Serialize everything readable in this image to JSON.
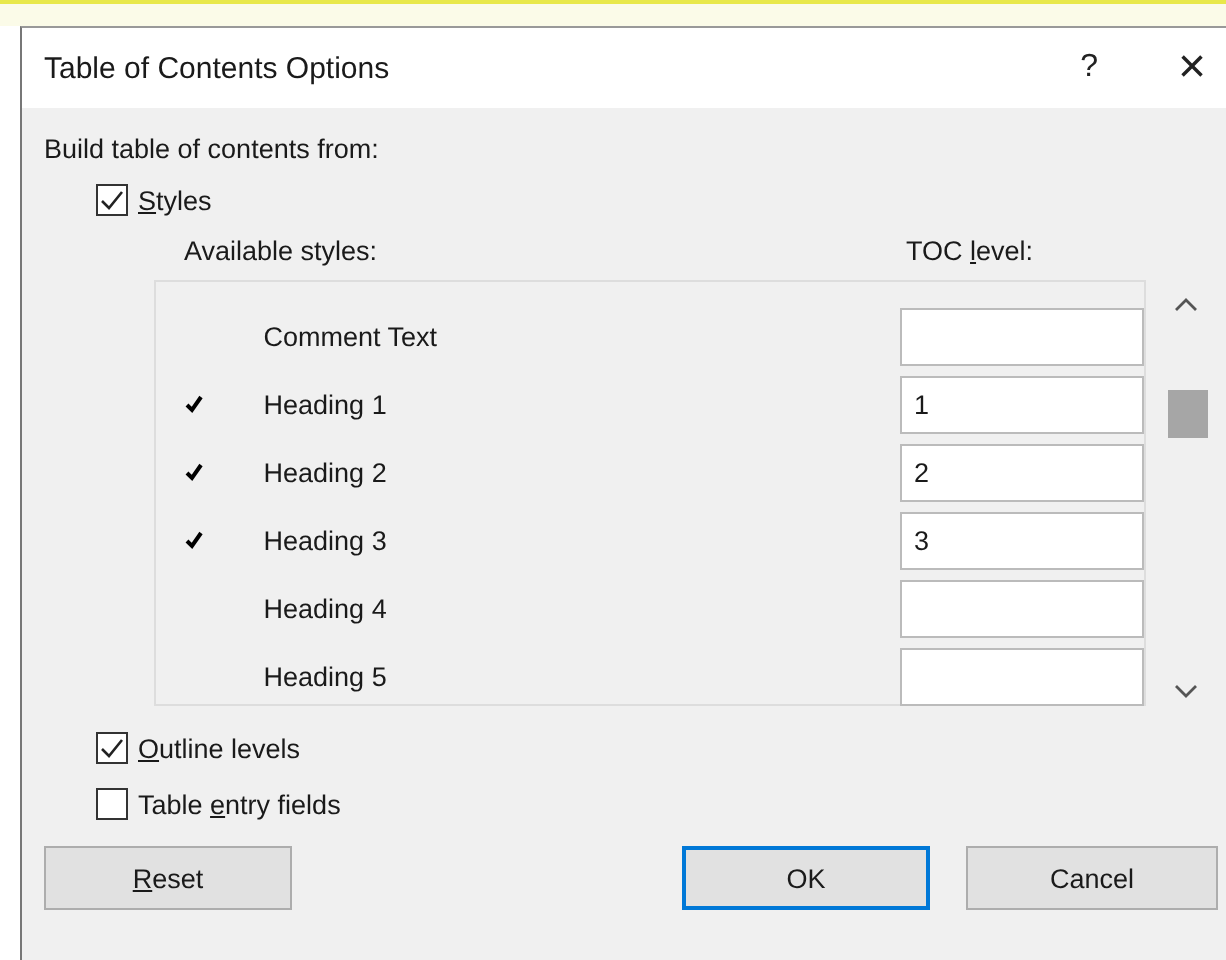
{
  "window": {
    "title": "Table of Contents Options",
    "help": "?",
    "close": "×"
  },
  "build_label": "Build table of contents from:",
  "styles_option": {
    "label": {
      "key": "S",
      "after": "tyles"
    },
    "checked": true
  },
  "columns": {
    "styles": "Available styles:",
    "level_label": {
      "before": "TOC ",
      "key": "l",
      "after": "evel:"
    }
  },
  "styles": [
    {
      "name": "Comment Text",
      "used": false
    },
    {
      "name": "Heading 1",
      "used": true,
      "level": "1"
    },
    {
      "name": "Heading 2",
      "used": true,
      "level": "2"
    },
    {
      "name": "Heading 3",
      "used": true,
      "level": "3"
    },
    {
      "name": "Heading 4",
      "used": false
    },
    {
      "name": "Heading 5",
      "used": false
    }
  ],
  "options": [
    {
      "label": {
        "key": "O",
        "after": "utline levels"
      },
      "checked": true
    },
    {
      "label": {
        "before": "Table ",
        "key": "e",
        "after": "ntry fields"
      },
      "checked": false
    }
  ],
  "buttons": [
    {
      "label": {
        "key": "R",
        "after": "eset"
      },
      "kind": "normal"
    },
    {
      "label": {
        "after": "OK"
      },
      "kind": "default"
    },
    {
      "label": {
        "after": "Cancel"
      },
      "kind": "normal"
    }
  ]
}
